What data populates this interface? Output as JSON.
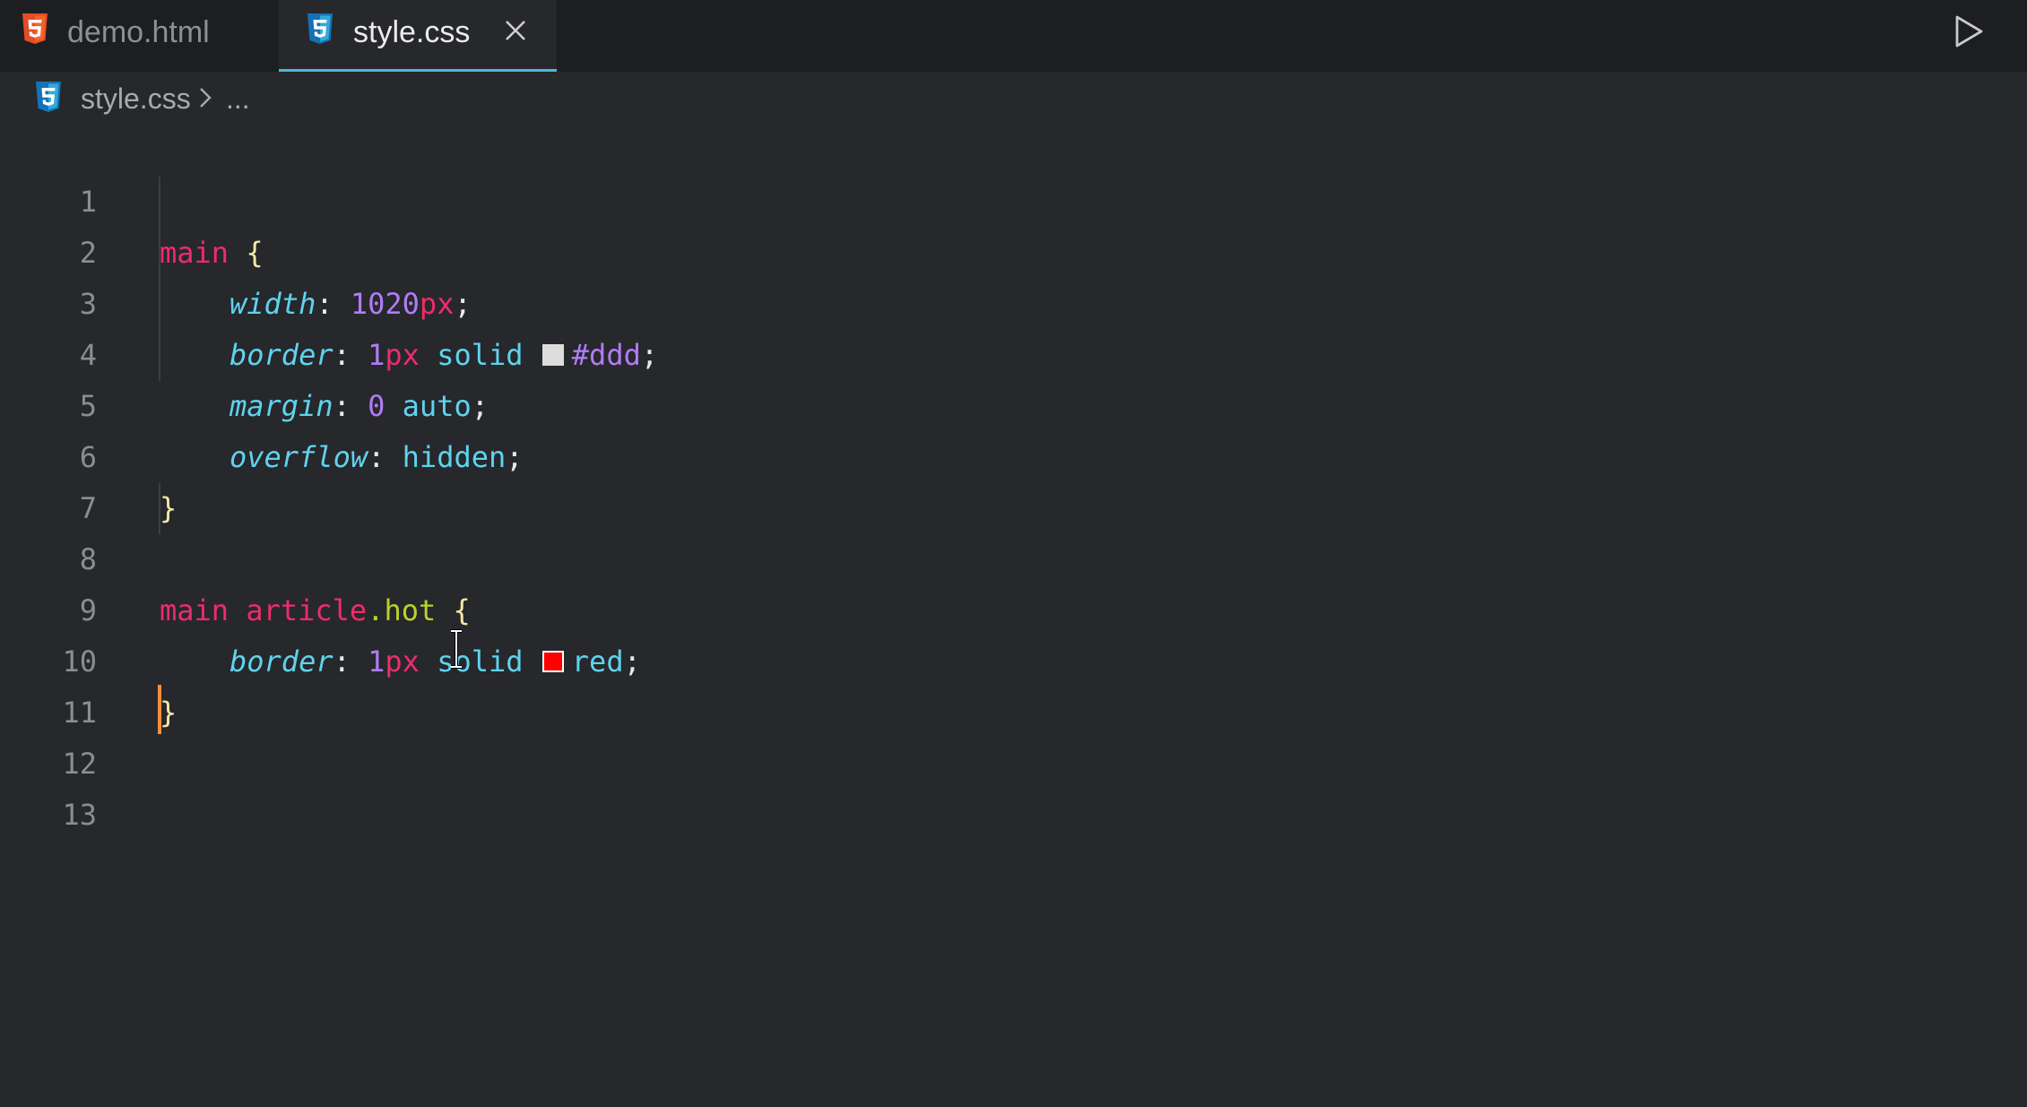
{
  "tabs": [
    {
      "label": "demo.html",
      "icon": "html5-icon",
      "active": false
    },
    {
      "label": "style.css",
      "icon": "css3-icon",
      "active": true,
      "closable": true
    }
  ],
  "toolbar": {
    "run_icon": "play-icon"
  },
  "breadcrumb": {
    "file": "style.css",
    "more": "..."
  },
  "editor": {
    "line_numbers": [
      "1",
      "2",
      "3",
      "4",
      "5",
      "6",
      "7",
      "8",
      "9",
      "10",
      "11",
      "12",
      "13"
    ],
    "code": {
      "l1": {
        "selector": "main",
        "open": "{"
      },
      "l2": {
        "prop": "width",
        "colon": ":",
        "num": "1020",
        "unit": "px",
        "semi": ";"
      },
      "l3": {
        "prop": "border",
        "colon": ":",
        "num": "1",
        "unit": "px",
        "kw": "solid",
        "color": "#ddd",
        "semi": ";"
      },
      "l4": {
        "prop": "margin",
        "colon": ":",
        "num": "0",
        "kw": "auto",
        "semi": ";"
      },
      "l5": {
        "prop": "overflow",
        "colon": ":",
        "kw": "hidden",
        "semi": ";"
      },
      "l6": {
        "close": "}"
      },
      "l8": {
        "tag1": "main",
        "tag2": "article",
        "dot": ".",
        "cls": "hot",
        "open": "{"
      },
      "l9": {
        "prop": "border",
        "colon": ":",
        "num": "1",
        "unit": "px",
        "kw": "solid",
        "color": "red",
        "semi": ";"
      },
      "l10": {
        "close": "}"
      }
    },
    "swatch_colors": {
      "ddd": "#dddddd",
      "red": "#ff0000"
    }
  },
  "colors": {
    "accent": "#4fb6dc",
    "caret": "#f1903a",
    "background": "#26282c",
    "tabbar": "#1c1e21"
  }
}
